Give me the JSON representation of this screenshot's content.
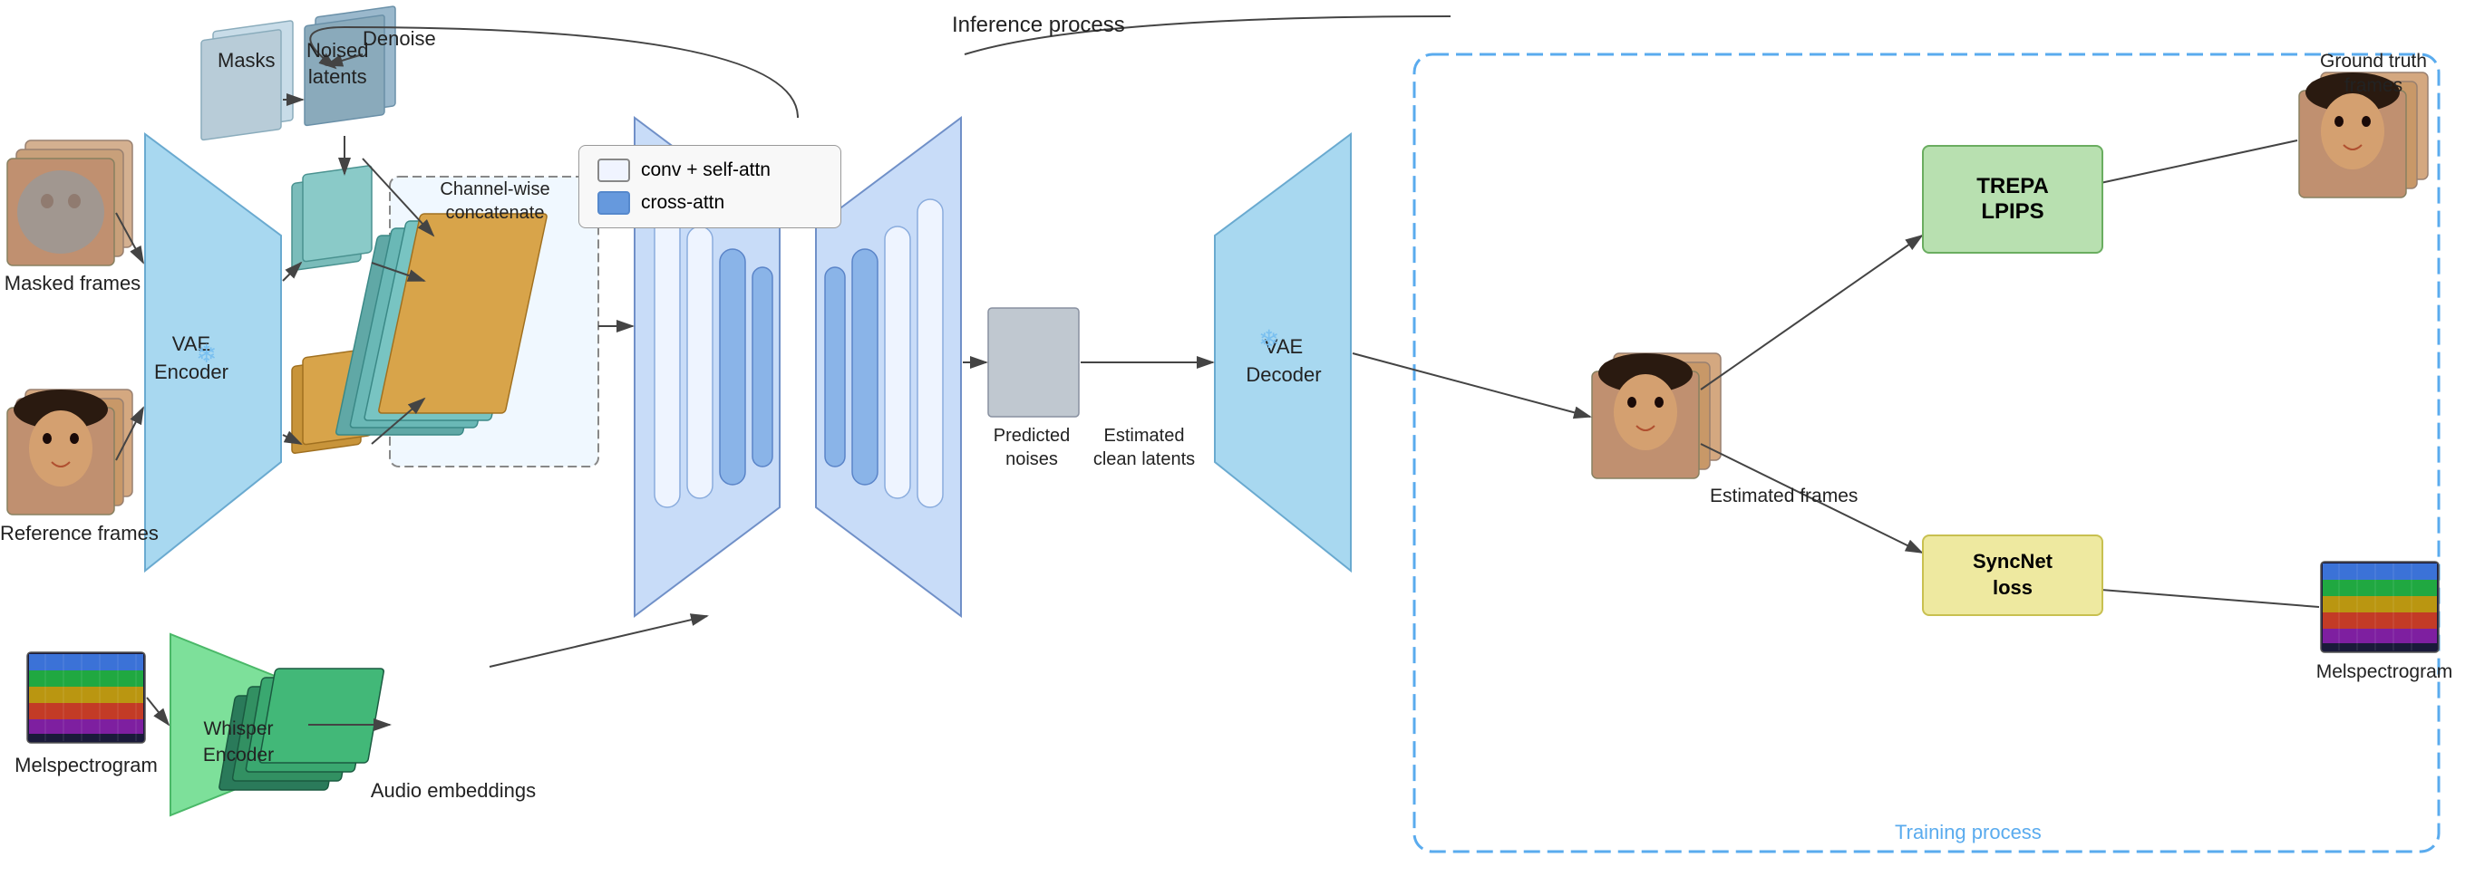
{
  "labels": {
    "masks": "Masks",
    "noised_latents": "Noised\nlatents",
    "denoise": "Denoise",
    "masked_frames": "Masked frames",
    "reference_frames": "Reference frames",
    "vae_encoder": "VAE\nEncoder",
    "channel_wise": "Channel-wise\nconcatenate",
    "whisper_encoder": "Whisper\nEncoder",
    "melspectrogram_bottom": "Melspectrogram",
    "audio_embeddings": "Audio embeddings",
    "predicted_noises": "Predicted\nnoises",
    "estimated_clean": "Estimated\nclean latents",
    "vae_decoder": "VAE\nDecoder",
    "inference_process": "Inference process",
    "training_process": "Training process",
    "ground_truth_frames": "Ground truth\nframes",
    "estimated_frames": "Estimated\nframes",
    "melspectrogram_right": "Melspectrogram",
    "conv_self_attn": "conv + self-attn",
    "cross_attn": "cross-attn",
    "trepa": "TREPA",
    "lpips": "LPIPS",
    "syncnet_loss": "SyncNet\nloss"
  },
  "colors": {
    "vae_encoder_fill": "#a8d8f0",
    "vae_decoder_fill": "#a8d8f0",
    "whisper_fill": "#7de09a",
    "unet_fill": "#c8dcf8",
    "unet_stroke": "#7090c8",
    "concat_colors": [
      "#7abcba",
      "#7abcba",
      "#7abcba",
      "#c8943a"
    ],
    "audio_embed_color": "#3a8a6a",
    "dashed_border": "#5aabee",
    "metric_green_bg": "#b8e0b0",
    "metric_green_border": "#6aad60",
    "metric_yellow_bg": "#eee9a0",
    "metric_yellow_border": "#c8c050",
    "mask_color": "#b0c8d8",
    "noised_color": "#8ab0c4",
    "latent_teal": "#7abcba",
    "latent_orange": "#c8943a"
  }
}
